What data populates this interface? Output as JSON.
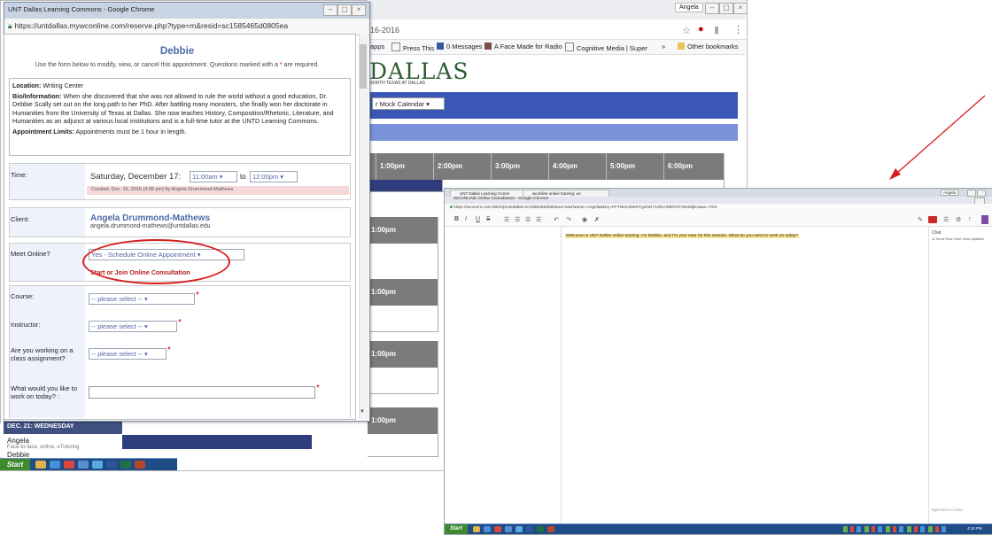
{
  "bg_window": {
    "user_chip": "Angela",
    "url_fragment": "16-2016",
    "bookmarks": [
      {
        "label": "Apps",
        "text": "apps"
      },
      {
        "label": "Press This"
      },
      {
        "label": "0 Messages"
      },
      {
        "label": "A Face Made for Radio"
      },
      {
        "label": "Cognitive Media | Super"
      },
      {
        "label": "»"
      },
      {
        "label": "Other bookmarks"
      }
    ],
    "logo": "DALLAS",
    "logo_sub": "NORTH TEXAS AT DALLAS",
    "calendar_select": "r Mock Calendar",
    "time_headers": [
      "1:00pm",
      "2:00pm",
      "3:00pm",
      "4:00pm",
      "5:00pm",
      "6:00pm"
    ],
    "row_headers": [
      "1:00pm",
      "1:00pm",
      "1:00pm",
      "1:00pm"
    ],
    "day_header": "DEC. 21: WEDNESDAY",
    "row_angela": "Angela",
    "row_angela_sub": "Face-to-face, online, eTutoring",
    "row_debbie": "Debbie",
    "taskbar_start": "Start"
  },
  "popup": {
    "title": "UNT Dallas Learning Commons - Google Chrome",
    "url": "https://untdallas.mywconline.com/reserve.php?type=m&resid=sc1585465d0805ea",
    "name": "Debbie",
    "instructions": "Use the form below to modify, view, or cancel this appointment. Questions marked with a",
    "instructions_end": "are required.",
    "location_label": "Location:",
    "location": "Writing Center",
    "bio_label": "Bio/Information:",
    "bio": "When she discovered that she was not allowed to rule the world without a good education, Dr. Debbie Scally set out on the long path to her PhD. After battling many monsters, she finally won her doctorate in Humanities from the University of Texas at Dallas. She now teaches History, Composition/Rhetoric, Literature, and Humanities as an adjunct at various local institutions and is a full-time tutor at the UNTD Learning Commons.",
    "limits_label": "Appointment Limits:",
    "limits": "Appointments must be 1 hour in length.",
    "time_label": "Time:",
    "time_date": "Saturday, December 17:",
    "time_start": "11:00am ▾",
    "time_to": "to",
    "time_end": "12:00pm ▾",
    "created": "Created: Dec. 16, 2016 (4:08 pm) by Angela Drummond-Mathews.",
    "client_label": "Client:",
    "client_name": "Angela Drummond-Mathews",
    "client_email": "angela.drummond-mathews@untdallas.edu",
    "meet_label": "Meet Online?",
    "meet_value": "Yes - Schedule Online Appointment",
    "consult_link": "Start or Join Online Consultation",
    "course_label": "Course:",
    "instructor_label": "Instructor:",
    "class_label": "Are you working on a class assignment?",
    "work_label": "What would you like to work on today? :",
    "placeholder_select": "-- please select --"
  },
  "consult_window": {
    "tab1": "UNT Dallas Learning Comm",
    "tab2": "wconline online tutoring: wc",
    "title": "WCONLINE Online Consultation - Google Chrome",
    "url": "https://wcoocm.com:9001/p/untdallas-sc1585465d0805ea?userName=Angela&key=PFTIBIC2MrNTg1NDY1ZDA4MDVlYSExMjE2&av=YES",
    "welcome": "Welcome to UNT Dallas online tutoring. I'm Debbie, and I'm your tutor for this session. What do you need to work on today?",
    "chat_label": "Chat",
    "chat_check": "Send Real Time Chat Updates",
    "chat_placeholder": "Type here to chat...",
    "user_chip": "Angela",
    "taskbar_start": "Start",
    "clock": "4:10 PM"
  },
  "colors": {
    "accent_blue": "#3a57b6",
    "light_blue": "#7a93da",
    "navy": "#303d7c",
    "annotation_red": "#d61e1e",
    "highlight_yellow": "#f7e58f"
  }
}
